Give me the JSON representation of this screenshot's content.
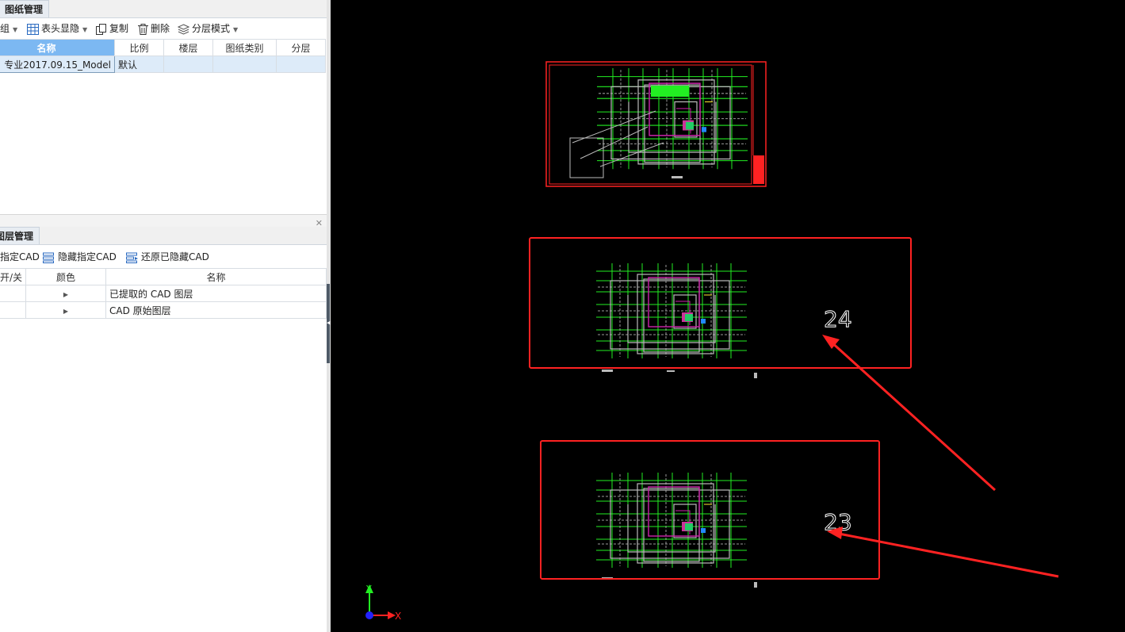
{
  "drawing_panel": {
    "tab_label": "图纸管理",
    "toolbar": {
      "group_label": "分组",
      "header_toggle_label": "表头显隐",
      "copy_label": "复制",
      "delete_label": "删除",
      "layer_mode_label": "分层模式"
    },
    "columns": [
      "名称",
      "比例",
      "楼层",
      "图纸类别",
      "分层"
    ],
    "rows": [
      {
        "name": "专业2017.09.15_Model",
        "scale": "默认",
        "floor": "",
        "category": "",
        "layer": ""
      }
    ]
  },
  "layer_panel": {
    "tab_label": "图层管理",
    "toolbar": {
      "show_label": "显示指定CAD",
      "hide_label": "隐藏指定CAD",
      "restore_label": "还原已隐藏CAD"
    },
    "columns": [
      "开/关",
      "颜色",
      "名称"
    ],
    "rows": [
      {
        "name": "已提取的 CAD 图层"
      },
      {
        "name": "CAD 原始图层"
      }
    ]
  },
  "cad_view": {
    "labels": {
      "upper": "24",
      "lower": "23"
    },
    "axes": {
      "x": "X",
      "y": "Y"
    },
    "colors": {
      "background": "#000000",
      "highlight": "#ff2222",
      "grid": "#22ee22",
      "outline": "#bbbbbb",
      "wall": "#cc22aa"
    }
  }
}
